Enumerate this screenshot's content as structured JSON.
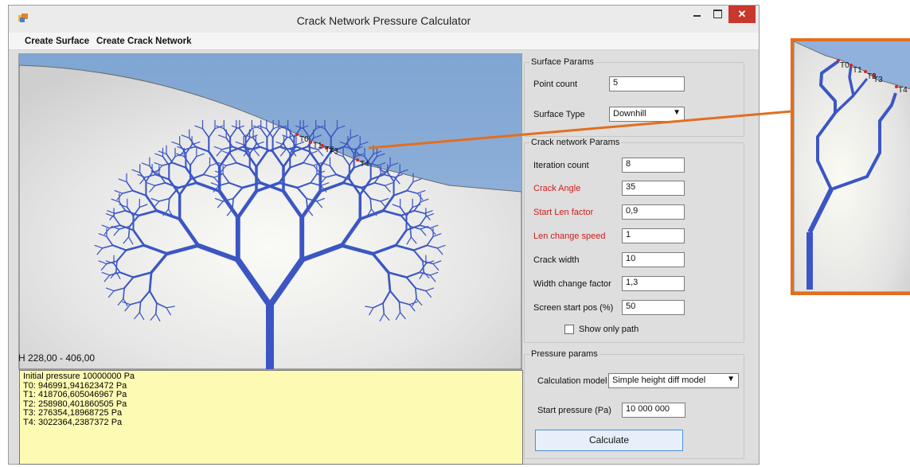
{
  "window": {
    "title": "Crack Network Pressure Calculator",
    "app_icon": "app-icon",
    "controls": {
      "close_label": "✕"
    }
  },
  "menu": {
    "create_surface": "Create Surface",
    "create_crack_network": "Create Crack Network"
  },
  "canvas": {
    "height_readout": "H 228,00 - 406,00",
    "points": [
      "T0",
      "T1",
      "T2",
      "T3",
      "T4"
    ],
    "sky_color": "#8aaed8",
    "ground_color": "#dcdcdc",
    "crack_color": "#3b56c4"
  },
  "log": {
    "lines": [
      "Initial pressure 10000000 Pa",
      "T0: 946991,941623472 Pa",
      "T1: 418706,605046967 Pa",
      "T2: 258980,401860505 Pa",
      "T3: 276354,18968725 Pa",
      "T4: 3022364,2387372 Pa"
    ]
  },
  "surface_params": {
    "title": "Surface Params",
    "point_count_label": "Point count",
    "point_count_value": "5",
    "surface_type_label": "Surface Type",
    "surface_type_value": "Downhill"
  },
  "crack_params": {
    "title": "Crack network Params",
    "iteration_count_label": "Iteration count",
    "iteration_count_value": "8",
    "crack_angle_label": "Crack Angle",
    "crack_angle_value": "35",
    "start_len_factor_label": "Start Len factor",
    "start_len_factor_value": "0,9",
    "len_change_speed_label": "Len change speed",
    "len_change_speed_value": "1",
    "crack_width_label": "Crack width",
    "crack_width_value": "10",
    "width_change_factor_label": "Width change factor",
    "width_change_factor_value": "1,3",
    "screen_start_pos_label": "Screen start pos (%)",
    "screen_start_pos_value": "50",
    "show_only_path_label": "Show only path"
  },
  "pressure_params": {
    "title": "Pressure params",
    "calculation_model_label": "Calculation model",
    "calculation_model_value": "Simple height diff model",
    "start_pressure_label": "Start pressure (Pa)",
    "start_pressure_value": "10 000 000",
    "calculate_label": "Calculate"
  },
  "zoom": {
    "points": [
      "T0",
      "T1",
      "T2",
      "T3",
      "T4"
    ],
    "border_color": "#e36e1f"
  }
}
